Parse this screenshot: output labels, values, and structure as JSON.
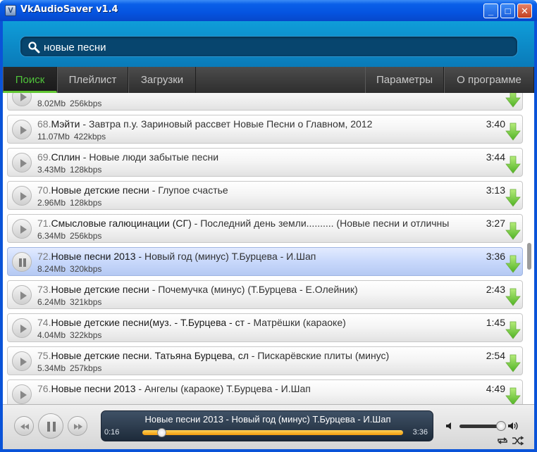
{
  "window": {
    "title": "VkAudioSaver v1.4",
    "minimize": "_",
    "maximize": "□",
    "close": "✕",
    "app_icon_glyph": "V"
  },
  "search": {
    "value": "новые песни",
    "placeholder": ""
  },
  "tabs": [
    {
      "label": "Поиск",
      "active": true
    },
    {
      "label": "Плейлист",
      "active": false
    },
    {
      "label": "Загрузки",
      "active": false
    },
    {
      "label": "Параметры",
      "active": false
    },
    {
      "label": "О программе",
      "active": false
    }
  ],
  "tracks": [
    {
      "num": "",
      "artist": "",
      "song": "",
      "duration": "",
      "size": "8.02Mb",
      "bitrate": "256kbps",
      "playing": false
    },
    {
      "num": "68.",
      "artist": "Мэйти",
      "song": "Завтра п.у. Зариновый рассвет Новые Песни о Главном, 2012",
      "duration": "3:40",
      "size": "11.07Mb",
      "bitrate": "422kbps",
      "playing": false
    },
    {
      "num": "69.",
      "artist": "Сплин",
      "song": "Новые люди забытые песни",
      "duration": "3:44",
      "size": "3.43Mb",
      "bitrate": "128kbps",
      "playing": false
    },
    {
      "num": "70.",
      "artist": "Новые детские песни",
      "song": "Глупое счастье",
      "duration": "3:13",
      "size": "2.96Mb",
      "bitrate": "128kbps",
      "playing": false
    },
    {
      "num": "71.",
      "artist": "Смысловые галюцинации (СГ)",
      "song": "Последний день земли.......... (Новые песни и отличны",
      "duration": "3:27",
      "size": "6.34Mb",
      "bitrate": "256kbps",
      "playing": false
    },
    {
      "num": "72.",
      "artist": "Новые песни 2013",
      "song": "Новый год (минус) Т.Бурцева - И.Шап",
      "duration": "3:36",
      "size": "8.24Mb",
      "bitrate": "320kbps",
      "playing": true
    },
    {
      "num": "73.",
      "artist": "Новые детские песни",
      "song": "Почемучка (минус) (Т.Бурцева - Е.Олейник)",
      "duration": "2:43",
      "size": "6.24Mb",
      "bitrate": "321kbps",
      "playing": false
    },
    {
      "num": "74.",
      "artist": "Новые детские песни(муз. - Т.Бурцева - ст",
      "song": "Матрёшки (караоке)",
      "duration": "1:45",
      "size": "4.04Mb",
      "bitrate": "322kbps",
      "playing": false
    },
    {
      "num": "75.",
      "artist": "Новые детские песни. Татьяна Бурцева, сл",
      "song": "Пискарёвские плиты (минус)",
      "duration": "2:54",
      "size": "5.34Mb",
      "bitrate": "257kbps",
      "playing": false
    },
    {
      "num": "76.",
      "artist": "Новые песни 2013",
      "song": "Ангелы (караоке) Т.Бурцева - И.Шап",
      "duration": "4:49",
      "size": "",
      "bitrate": "",
      "playing": false
    }
  ],
  "separator": " - ",
  "player": {
    "now_playing": "Новые песни 2013 - Новый год (минус) Т.Бурцева - И.Шап",
    "current_time": "0:16",
    "total_time": "3:36",
    "progress": 0.074,
    "volume": 0.95
  },
  "colors": {
    "accent_green": "#62c733",
    "title_blue": "#0554e0",
    "search_bg": "#0a7ab8"
  },
  "icons": {
    "search": "search-icon",
    "download": "download-arrow-icon",
    "play": "play-icon",
    "pause": "pause-icon"
  }
}
